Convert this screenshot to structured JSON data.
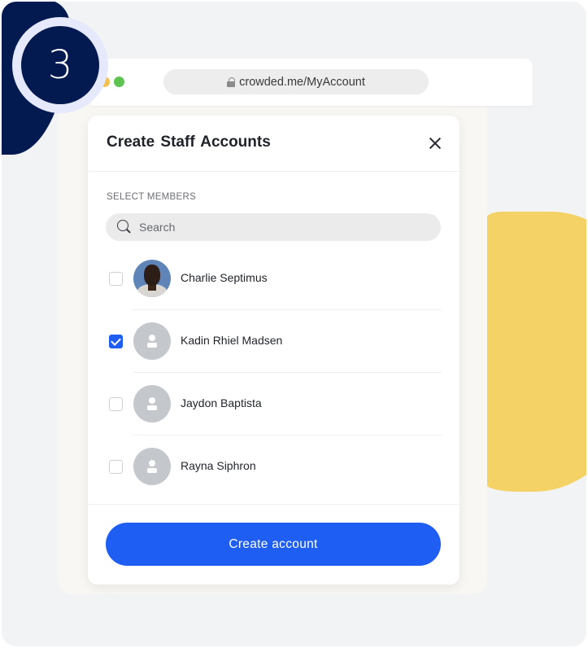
{
  "step": {
    "number": "3"
  },
  "browser": {
    "url": "crowded.me/MyAccount",
    "lock_icon": "lock-icon",
    "window_dots": [
      "yellow",
      "green"
    ]
  },
  "modal": {
    "title": "Create  Staff Accounts",
    "close_icon": "close-icon",
    "section_label": "SELECT MEMBERS",
    "search": {
      "placeholder": "Search",
      "value": "",
      "icon": "search-icon"
    },
    "members": [
      {
        "name": "Charlie Septimus",
        "checked": false,
        "avatar": "photo"
      },
      {
        "name": "Kadin Rhiel Madsen",
        "checked": true,
        "avatar": "placeholder-person-icon"
      },
      {
        "name": "Jaydon Baptista",
        "checked": false,
        "avatar": "placeholder-person-icon"
      },
      {
        "name": "Rayna Siphron",
        "checked": false,
        "avatar": "placeholder-person-icon"
      }
    ],
    "create_button": "Create account"
  },
  "colors": {
    "accent": "#1f5ef2",
    "navy": "#021a4f",
    "yellow": "#f4d266",
    "background": "#f2f3f5"
  }
}
